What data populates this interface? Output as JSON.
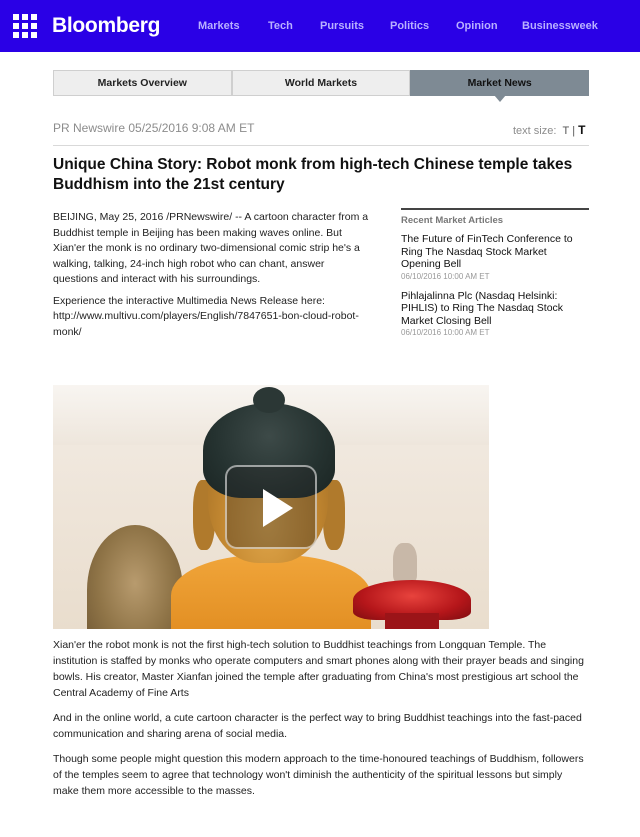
{
  "header": {
    "logo": "Bloomberg",
    "nav": [
      "Markets",
      "Tech",
      "Pursuits",
      "Politics",
      "Opinion",
      "Businessweek"
    ]
  },
  "tabs": [
    {
      "label": "Markets Overview",
      "active": false
    },
    {
      "label": "World Markets",
      "active": false
    },
    {
      "label": "Market News",
      "active": true
    }
  ],
  "byline": {
    "source": "PR Newswire",
    "datetime": "05/25/2016 9:08 AM ET",
    "text_size_label": "text size:",
    "text_size_small": "T",
    "text_size_sep": "|",
    "text_size_large": "T"
  },
  "headline": "Unique China Story: Robot monk from high-tech Chinese temple takes Buddhism into the 21st century",
  "intro": [
    "BEIJING, May 25, 2016 /PRNewswire/ -- A cartoon character from a Buddhist temple in Beijing has been making waves online. But Xian'er the monk is no ordinary two-dimensional comic strip he's a walking, talking, 24-inch high robot who can chant, answer questions and interact with his surroundings.",
    "Experience the interactive Multimedia News Release here: http://www.multivu.com/players/English/7847651-bon-cloud-robot-monk/"
  ],
  "sidebar": {
    "heading": "Recent Market Articles",
    "items": [
      {
        "title": "The Future of FinTech Conference to Ring The Nasdaq Stock Market Opening Bell",
        "date": "06/10/2016 10:00 AM ET"
      },
      {
        "title": "Pihlajalinna Plc (Nasdaq Helsinki: PIHLIS) to Ring The Nasdaq Stock Market Closing Bell",
        "date": "06/10/2016 10:00 AM ET"
      }
    ]
  },
  "video": {
    "icon": "play-icon"
  },
  "body": [
    "Xian'er the robot monk is not the first high-tech solution to Buddhist teachings from Longquan Temple. The institution is staffed by monks who operate computers and smart phones along with their prayer beads and singing bowls. His creator, Master Xianfan joined the temple after graduating from China's most prestigious art school the Central Academy of Fine Arts",
    "And in the online world, a cute cartoon character is the perfect way to bring Buddhist teachings into the fast-paced communication and sharing arena of social media.",
    "Though some people might question this modern approach to the time-honoured teachings of Buddhism, followers of the temples seem to agree that technology won't diminish the authenticity of the spiritual lessons but simply make them more accessible to the masses."
  ],
  "colors": {
    "brand_bar": "#2a00e6",
    "nav_text": "#b9b0ff",
    "active_tab": "#7e8a94"
  }
}
